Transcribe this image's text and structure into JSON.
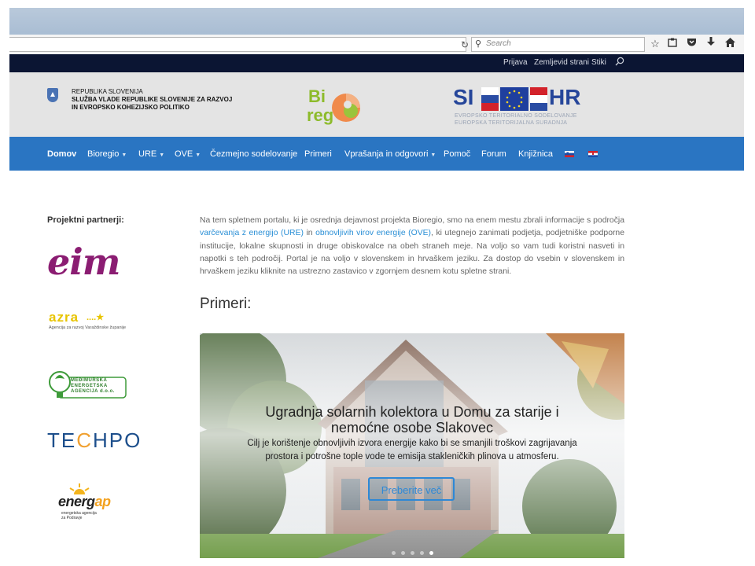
{
  "browser": {
    "search_placeholder": "Search",
    "icons": [
      "reload-icon",
      "star-icon",
      "clipboard-icon",
      "pocket-icon",
      "download-icon",
      "home-icon"
    ]
  },
  "topbar": {
    "links": [
      "Prijava",
      "Zemljevid strani",
      "Stiki"
    ]
  },
  "header": {
    "gov_line1": "REPUBLIKA SLOVENIJA",
    "gov_line2": "SLUŽBA VLADE REPUBLIKE SLOVENIJE ZA RAZVOJ",
    "gov_line3": "IN EVROPSKO KOHEZIJSKO POLITIKO",
    "bioregio_bi": "Bi",
    "bioregio_reg": "reg",
    "sihr_si": "SI",
    "sihr_hr": "HR",
    "sihr_line1": "EVROPSKO TERITORIALNO SODELOVANJE",
    "sihr_line2": "EUROPSKA TERITORIJALNA SURADNJA"
  },
  "nav": {
    "items": [
      {
        "label": "Domov",
        "dropdown": false,
        "active": true
      },
      {
        "label": "Bioregio",
        "dropdown": true
      },
      {
        "label": "URE",
        "dropdown": true
      },
      {
        "label": "OVE",
        "dropdown": true
      },
      {
        "label": "Čezmejno sodelovanje",
        "dropdown": false
      },
      {
        "label": "Primeri",
        "dropdown": false
      },
      {
        "label": "Vprašanja in odgovori",
        "dropdown": true
      },
      {
        "label": "Pomoč",
        "dropdown": false
      },
      {
        "label": "Forum",
        "dropdown": false
      },
      {
        "label": "Knjižnica",
        "dropdown": false
      }
    ],
    "caret": "▼",
    "flags": [
      "slovenia-flag-icon",
      "croatia-flag-icon"
    ]
  },
  "sidebar": {
    "title": "Projektni partnerji:",
    "partners": [
      {
        "name": "eim",
        "color": "#8b1d72"
      },
      {
        "name": "azra",
        "tagline": "Agencija za razvoj Varaždinske županije",
        "dots": "....★"
      },
      {
        "name": "MEĐIMURSKA ENERGETSKA AGENCIJA d.o.o."
      },
      {
        "name_a": "TE",
        "name_c": "C",
        "name_b": "HPO",
        "color": "#1d4f8c"
      },
      {
        "name_main": "energ",
        "name_ap": "ap",
        "tagline1": "energetska agencija",
        "tagline2": "za Podravje"
      }
    ]
  },
  "main": {
    "intro_p1": "Na tem spletnem portalu, ki je osrednja dejavnost projekta Bioregio, smo na enem mestu zbrali informacije s področja ",
    "intro_link1": "varčevanja z energijo (URE)",
    "intro_p2": " in ",
    "intro_link2": "obnovljivih virov energije (OVE)",
    "intro_p3": ", ki utegnejo zanimati podjetja, podjetniške podporne institucije, lokalne skupnosti in druge obiskovalce na obeh straneh meje. Na voljo so vam tudi koristni nasveti in napotki s teh področij. Portal je na voljo v slovenskem in hrvaškem jeziku. Za dostop do vsebin v slovenskem in hrvaškem jeziku kliknite na ustrezno zastavico v zgornjem desnem kotu spletne strani.",
    "section_title": "Primeri:",
    "slider": {
      "title_line1": "Ugradnja solarnih kolektora u Domu za starije i",
      "title_line2": "nemoćne osobe Slakovec",
      "desc_line1": "Cilj je korištenje obnovljivih izvora energije kako bi se smanjili troškovi zagrijavanja",
      "desc_line2": "prostora i potrošne tople vode te emisija stakleničkih plinova u atmosferu.",
      "button": "Preberite več",
      "slide_count": 5,
      "active_slide": 5
    }
  },
  "colors": {
    "topbar_bg": "#0b1533",
    "nav_bg": "#2a75c2",
    "link": "#2a8fd6",
    "header_bg": "#e4e4e4"
  }
}
